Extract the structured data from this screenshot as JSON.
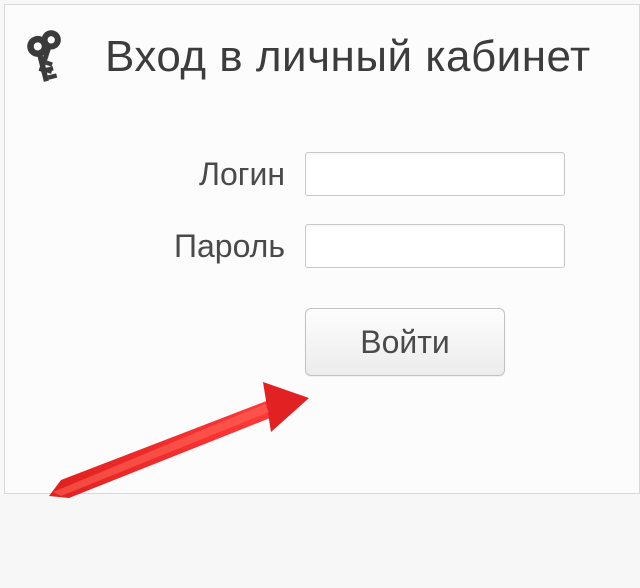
{
  "header": {
    "title": "Вход в личный кабинет",
    "icon": "keys-icon"
  },
  "form": {
    "login": {
      "label": "Логин",
      "value": ""
    },
    "password": {
      "label": "Пароль",
      "value": ""
    }
  },
  "actions": {
    "submit_label": "Войти"
  },
  "annotation": {
    "arrow_color": "#e02020"
  }
}
